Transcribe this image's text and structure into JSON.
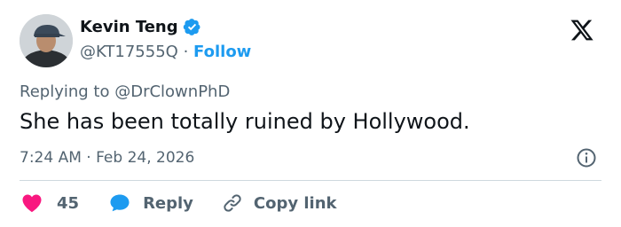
{
  "author": {
    "display_name": "Kevin Teng",
    "handle": "@KT17555Q",
    "separator": "·",
    "follow_label": "Follow",
    "verified": true
  },
  "tweet": {
    "replying_prefix": "Replying to",
    "replying_handle": "@DrClownPhD",
    "text": "She has been totally ruined by Hollywood.",
    "timestamp": "7:24 AM · Feb 24, 2026"
  },
  "actions": {
    "like_count": "45",
    "reply_label": "Reply",
    "copy_link_label": "Copy link"
  },
  "colors": {
    "accent": "#1d9bf0",
    "like": "#f91880",
    "text": "#0f1419",
    "muted": "#536471",
    "divider": "#cfd9de"
  },
  "icons": [
    "verified-badge-icon",
    "x-logo-icon",
    "info-icon",
    "heart-icon",
    "reply-bubble-icon",
    "link-icon"
  ]
}
